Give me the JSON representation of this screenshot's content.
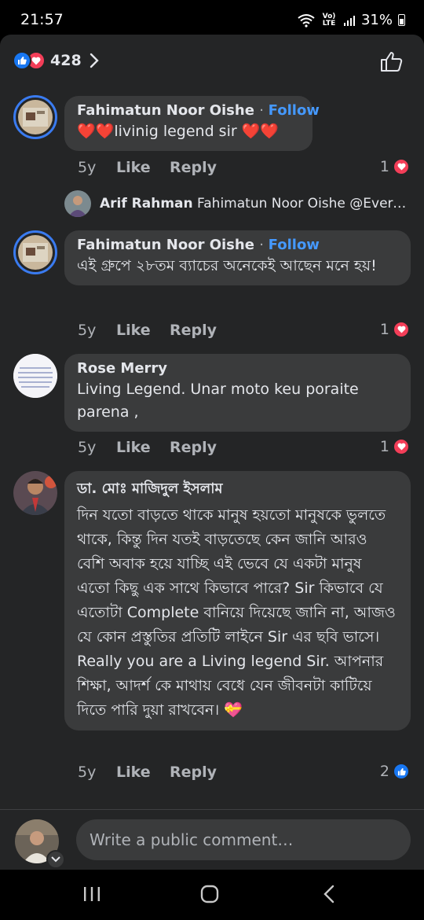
{
  "status_bar": {
    "time": "21:57",
    "network_label": "Vo) LTE",
    "battery": "31%"
  },
  "reactions": {
    "count": "428"
  },
  "comments": [
    {
      "author": "Fahimatun Noor Oishe",
      "follow": "Follow",
      "text": "❤️❤️livinig legend sir ❤️❤️",
      "age": "5y",
      "like": "Like",
      "reply": "Reply",
      "reaction_count": "1",
      "reaction_type": "love"
    },
    {
      "author": "Fahimatun Noor Oishe",
      "follow": "Follow",
      "text": "এই গ্রুপে ২৮তম ব্যাচের অনেকেই আছেন মনে হয়!",
      "age": "5y",
      "like": "Like",
      "reply": "Reply",
      "reaction_count": "1",
      "reaction_type": "love"
    },
    {
      "author": "Rose Merry",
      "text": "Living Legend. Unar moto keu poraite parena ,",
      "age": "5y",
      "like": "Like",
      "reply": "Reply",
      "reaction_count": "1",
      "reaction_type": "love"
    },
    {
      "author": "ডা. মোঃ মাজিদুল ইসলাম",
      "text": "দিন যতো বাড়তে থাকে মানুষ হয়তো মানুষকে ভুলতে থাকে, কিন্তু দিন যতই বাড়তেছে কেন জানি আরও বেশি অবাক হয়ে যাচ্ছি এই ভেবে যে একটা মানুষ এতো কিছু এক সাথে কিভাবে পারে? Sir কিভাবে যে এতোটা Complete বানিয়ে দিয়েছে জানি না, আজও যে কোন প্রস্তুতির প্রতিটি লাইনে Sir এর ছবি ভাসে। Really you are a Living legend Sir. আপনার শিক্ষা, আদর্শ কে মাথায় বেধে যেন জীবনটা কাটিয়ে দিতে পারি দুয়া রাখবেন। 💝",
      "age": "5y",
      "like": "Like",
      "reply": "Reply",
      "reaction_count": "2",
      "reaction_type": "like"
    }
  ],
  "reply_preview": {
    "author": "Arif Rahman",
    "text": "Fahimatun Noor Oishe @Evergre…"
  },
  "composer": {
    "placeholder": "Write a public comment…"
  },
  "colors": {
    "background": "#242526",
    "bubble": "#3a3b3c",
    "accent": "#4599ff",
    "like_blue": "#1877f2",
    "love_red": "#f33e58"
  }
}
